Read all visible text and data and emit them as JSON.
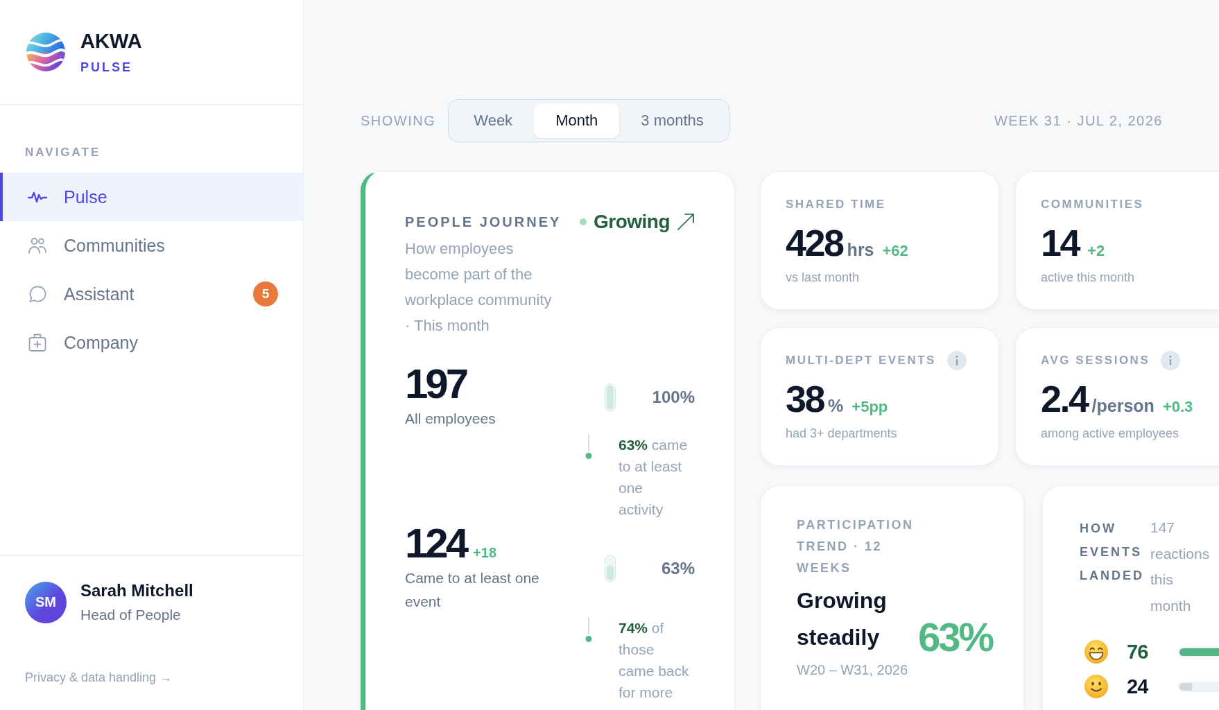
{
  "sidebar": {
    "brand": {
      "name": "AKWA",
      "product": "PULSE"
    },
    "nav_heading": "NAVIGATE",
    "nav_items": [
      {
        "label": "Pulse",
        "kind": "pulse",
        "selected": true
      },
      {
        "label": "Communities",
        "kind": "people",
        "selected": false
      },
      {
        "label": "Assistant",
        "kind": "chat",
        "selected": false,
        "badge": "5"
      },
      {
        "label": "Company",
        "kind": "kit",
        "selected": false
      }
    ],
    "user": {
      "initials": "SM",
      "name": "Sarah Mitchell",
      "role": "Head of People"
    },
    "privacy_link": "Privacy & data handling →"
  },
  "toolbar": {
    "showing_label": "SHOWING",
    "periods": [
      {
        "label": "Week",
        "selected": false
      },
      {
        "label": "Month",
        "selected": true
      },
      {
        "label": "3 months",
        "selected": false
      }
    ],
    "date": "WEEK 31 · JUL 2, 2026"
  },
  "people_journey": {
    "title": "PEOPLE JOURNEY",
    "status": "Growing",
    "description": "How employees become part of the workplace community · This month",
    "stages": [
      {
        "value": "197",
        "label": "All employees",
        "percent": "100%",
        "level": 1,
        "conversion": "**63%** came to at least one activity"
      },
      {
        "value": "124",
        "delta": "+18",
        "label": "Came to at least one event",
        "percent": "63%",
        "level": 0.63,
        "conversion": "**74%** of those came back for more"
      }
    ]
  },
  "stat_cards": [
    {
      "title": "SHARED TIME",
      "value": "428",
      "unit": "hrs",
      "delta": "+62",
      "caption": "vs last month",
      "info": false
    },
    {
      "title": "COMMUNITIES",
      "value": "14",
      "delta": "+2",
      "caption": "active this month",
      "info": false
    },
    {
      "title": "MULTI-DEPT EVENTS",
      "value": "38",
      "unit": "%",
      "delta": "+5pp",
      "caption": "had 3+ departments",
      "info": true
    },
    {
      "title": "AVG SESSIONS",
      "value": "2.4",
      "unit": "/person",
      "delta": "+0.3",
      "caption": "among active employees",
      "info": true
    }
  ],
  "participation": {
    "title": "PARTICIPATION TREND · 12 WEEKS",
    "headline": "Growing steadily",
    "percent": "63%",
    "range": "W20 – W31, 2026"
  },
  "events_landed": {
    "title": "HOW EVENTS LANDED",
    "summary": "147 reactions this month",
    "reactions": [
      {
        "kind": "grin",
        "count": "76",
        "level": 1,
        "highlighted": true
      },
      {
        "kind": "smile",
        "count": "24",
        "level": 0.32,
        "highlighted": false
      }
    ]
  }
}
